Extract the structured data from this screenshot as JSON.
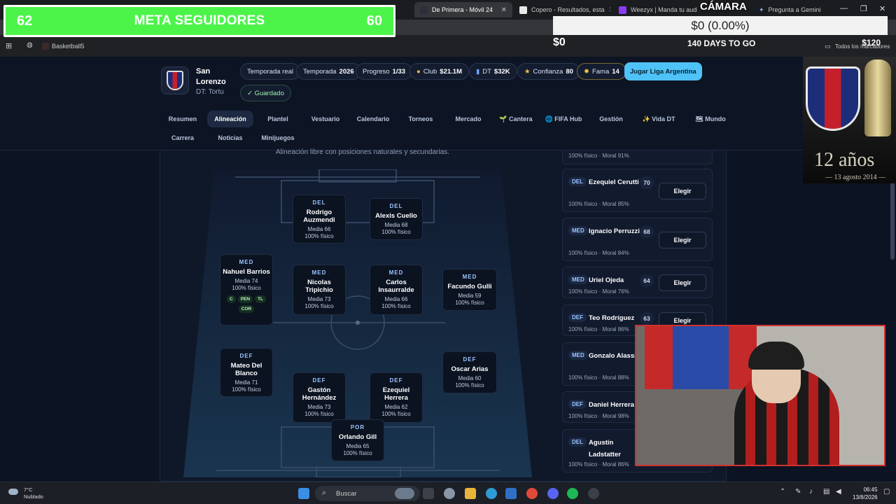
{
  "browser": {
    "tabs": [
      {
        "label": "De Primera - Móvil 24",
        "active": true
      },
      {
        "label": "Copero - Resultados, esta",
        "active": false
      },
      {
        "label": "Weezyx | Manda tu audio",
        "active": false
      },
      {
        "label": "Pregunta a Gemini",
        "active": false
      }
    ],
    "bookmark": "Basketball5",
    "bookmarks_right": "Todos los marcadores"
  },
  "overlay": {
    "meta_left": "62",
    "meta_title": "META SEGUIDORES",
    "meta_right": "60",
    "camara": "CÁMARA",
    "money": "$0 (0.00%)",
    "money_left": "$0",
    "days": "140 DAYS TO GO",
    "money_right": "$120",
    "trophy_title": "12 años",
    "trophy_date": "— 13 agosto 2014 —"
  },
  "club": {
    "name": "San Lorenzo",
    "dt": "DT: Tortu"
  },
  "pills": {
    "mode": "Temporada real",
    "season_label": "Temporada",
    "season_value": "2026",
    "progress_label": "Progreso",
    "progress_value": "1/33",
    "club_label": "Club",
    "club_value": "$21.1M",
    "dt_label": "DT",
    "dt_value": "$32K",
    "conf_label": "Confianza",
    "conf_value": "80",
    "fame_label": "Fama",
    "fame_value": "14",
    "cta": "Jugar Liga Argentina",
    "saved": "✓ Guardado"
  },
  "nav": {
    "row1": [
      "Resumen",
      "Alineación",
      "Plantel",
      "Vestuario",
      "Calendario",
      "Torneos",
      "Mercado",
      "🌱 Cantera",
      "🌐 FIFA Hub",
      "Gestión",
      "✨ Vida DT",
      "🗺 Mundo"
    ],
    "row2": [
      "Carrera",
      "Noticias",
      "Minijuegos"
    ],
    "active": "Alineación"
  },
  "lineup": {
    "subtitle": "Alineación libre con posiciones naturales y secundarias.",
    "players": [
      {
        "pos": "DEL",
        "name": "Rodrigo Auzmendi",
        "media": "Media 66",
        "fisico": "100% físico"
      },
      {
        "pos": "DEL",
        "name": "Alexis Cuello",
        "media": "Media 68",
        "fisico": "100% físico"
      },
      {
        "pos": "MED",
        "name": "Nahuel Barrios",
        "media": "Media 74",
        "fisico": "100% físico",
        "chips": [
          "C",
          "PEN",
          "TL",
          "COR"
        ]
      },
      {
        "pos": "MED",
        "name": "Nicolas Tripichio",
        "media": "Media 73",
        "fisico": "100% físico"
      },
      {
        "pos": "MED",
        "name": "Carlos Insaurralde",
        "media": "Media 66",
        "fisico": "100% físico"
      },
      {
        "pos": "MED",
        "name": "Facundo Gulli",
        "media": "Media 59",
        "fisico": "100% físico"
      },
      {
        "pos": "DEF",
        "name": "Mateo Del Blanco",
        "media": "Media 71",
        "fisico": "100% físico"
      },
      {
        "pos": "DEF",
        "name": "Oscar Arias",
        "media": "Media 60",
        "fisico": "100% físico"
      },
      {
        "pos": "DEF",
        "name": "Gastón Hernández",
        "media": "Media 73",
        "fisico": "100% físico"
      },
      {
        "pos": "DEF",
        "name": "Ezequiel Herrera",
        "media": "Media 62",
        "fisico": "100% físico"
      },
      {
        "pos": "POR",
        "name": "Orlando Gill",
        "media": "Media 65",
        "fisico": "100% físico"
      }
    ]
  },
  "bench": {
    "top_status": "100% físico · Moral 91%",
    "button": "Elegir",
    "rows": [
      {
        "pos": "DEL",
        "name": "Ezequiel Cerutti",
        "ovr": "70",
        "status": "100% físico · Moral 85%"
      },
      {
        "pos": "MED",
        "name": "Ignacio Perruzzi",
        "ovr": "68",
        "status": "100% físico · Moral 84%"
      },
      {
        "pos": "MED",
        "name": "Uriel Ojeda",
        "ovr": "64",
        "status": "100% físico · Moral 76%"
      },
      {
        "pos": "DEF",
        "name": "Teo Rodríguez",
        "ovr": "63",
        "status": "100% físico · Moral 86%"
      },
      {
        "pos": "MED",
        "name": "Gonzalo Alassia",
        "ovr": "",
        "status": "100% físico · Moral 88%"
      },
      {
        "pos": "DEF",
        "name": "Daniel Herrera",
        "ovr": "",
        "status": "100% físico · Moral 98%"
      },
      {
        "pos": "DEL",
        "name": "Agustín Ladstatter",
        "ovr": "",
        "status": "100% físico · Moral 86%"
      }
    ]
  },
  "taskbar": {
    "temp": "7°C",
    "weather": "Nublado",
    "search": "Buscar",
    "time": "06:45",
    "date": "13/8/2026"
  }
}
